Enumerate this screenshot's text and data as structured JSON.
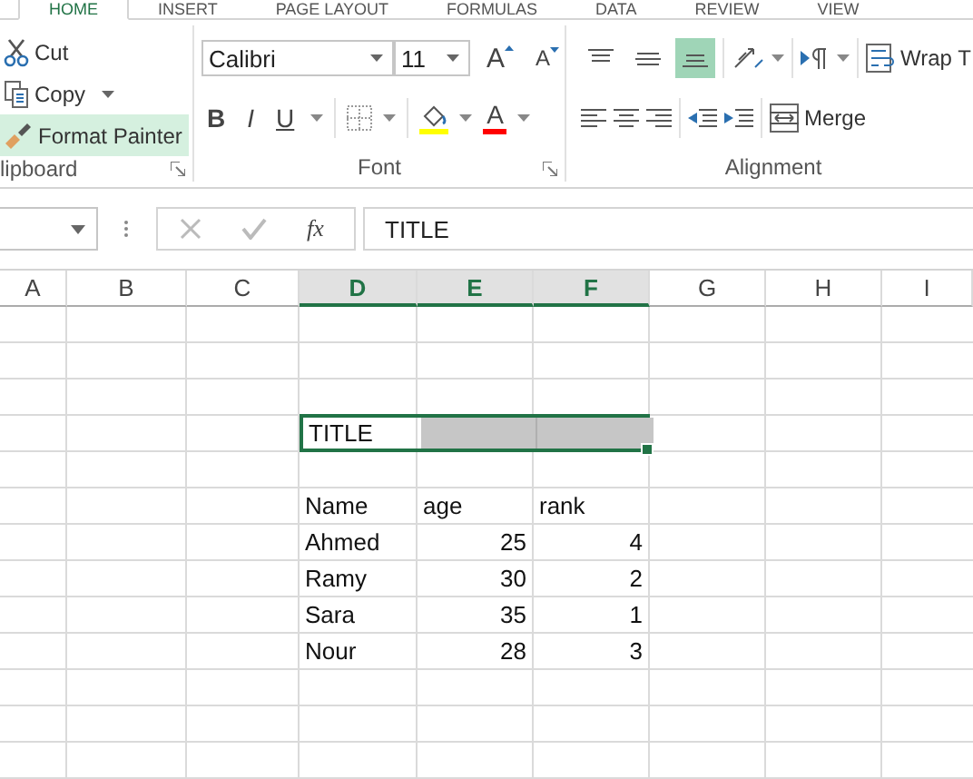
{
  "tabs": [
    {
      "label": "HOME",
      "selected": true
    },
    {
      "label": "INSERT",
      "selected": false
    },
    {
      "label": "PAGE LAYOUT",
      "selected": false
    },
    {
      "label": "FORMULAS",
      "selected": false
    },
    {
      "label": "DATA",
      "selected": false
    },
    {
      "label": "REVIEW",
      "selected": false
    },
    {
      "label": "VIEW",
      "selected": false
    }
  ],
  "clipboard": {
    "label": "lipboard",
    "buttons": [
      {
        "kind": "cut",
        "label": "Cut",
        "active": false
      },
      {
        "kind": "copy",
        "label": "Copy",
        "active": false
      },
      {
        "kind": "painter",
        "label": "Format Painter",
        "active": true
      }
    ]
  },
  "font": {
    "label": "Font",
    "family": "Calibri",
    "size": "11",
    "grow": "A",
    "shrink": "A",
    "bold": "B",
    "italic": "I",
    "underline": "U",
    "font_color_letter": "A"
  },
  "alignment": {
    "label": "Alignment",
    "vertical": [
      {
        "kind": "top",
        "selected": false
      },
      {
        "kind": "middle",
        "selected": false
      },
      {
        "kind": "bottom",
        "selected": true
      }
    ],
    "wrap": "Wrap T",
    "merge": "Merge"
  },
  "formula_bar": {
    "insert_function": "fx",
    "value": "TITLE"
  },
  "columns": [
    {
      "label": "A",
      "selected": false
    },
    {
      "label": "B",
      "selected": false
    },
    {
      "label": "C",
      "selected": false
    },
    {
      "label": "D",
      "selected": true
    },
    {
      "label": "E",
      "selected": true
    },
    {
      "label": "F",
      "selected": true
    },
    {
      "label": "G",
      "selected": false
    },
    {
      "label": "H",
      "selected": false
    },
    {
      "label": "I",
      "selected": false
    }
  ],
  "title_cell": "TITLE",
  "table": {
    "columns": [
      "Name",
      "age",
      "rank"
    ],
    "rows": [
      [
        "Ahmed",
        "25",
        "4"
      ],
      [
        "Ramy",
        "30",
        "2"
      ],
      [
        "Sara",
        "35",
        "1"
      ],
      [
        "Nour",
        "28",
        "3"
      ]
    ]
  }
}
